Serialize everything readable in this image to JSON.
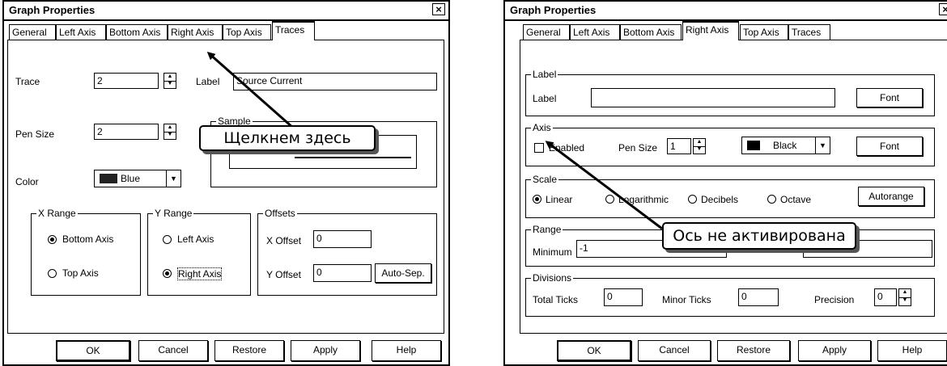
{
  "left_dialog": {
    "title": "Graph Properties",
    "close": "×",
    "tabs": [
      "General",
      "Left Axis",
      "Bottom Axis",
      "Right Axis",
      "Top Axis",
      "Traces"
    ],
    "active_tab": "Traces",
    "trace": {
      "label": "Trace",
      "value": "2"
    },
    "pen_size": {
      "label": "Pen Size",
      "value": "2"
    },
    "label_field": {
      "label": "Label",
      "value": "Source Current"
    },
    "sample": {
      "label": "Sample"
    },
    "color": {
      "label": "Color",
      "value": "Blue",
      "swatch": "#333333"
    },
    "x_range": {
      "label": "X Range",
      "options": [
        "Bottom Axis",
        "Top Axis"
      ],
      "selected": "Bottom Axis"
    },
    "y_range": {
      "label": "Y Range",
      "options": [
        "Left Axis",
        "Right Axis"
      ],
      "selected": "Right Axis"
    },
    "offsets": {
      "label": "Offsets",
      "x_label": "X Offset",
      "x_value": "0",
      "y_label": "Y Offset",
      "y_value": "0",
      "auto_sep": "Auto-Sep."
    },
    "buttons": {
      "ok": "OK",
      "cancel": "Cancel",
      "restore": "Restore",
      "apply": "Apply",
      "help": "Help"
    }
  },
  "right_dialog": {
    "title": "Graph Properties",
    "close": "×",
    "tabs": [
      "General",
      "Left Axis",
      "Bottom Axis",
      "Right Axis",
      "Top Axis",
      "Traces"
    ],
    "active_tab": "Right Axis",
    "label_group": {
      "label": "Label",
      "field_label": "Label",
      "value": "",
      "font": "Font"
    },
    "axis_group": {
      "label": "Axis",
      "enabled": "Enabled",
      "enabled_checked": false,
      "pen_size_label": "Pen Size",
      "pen_size": "1",
      "color": "Black",
      "font": "Font"
    },
    "scale_group": {
      "label": "Scale",
      "options": [
        "Linear",
        "Logarithmic",
        "Decibels",
        "Octave"
      ],
      "selected": "Linear",
      "autorange": "Autorange"
    },
    "range_group": {
      "label": "Range",
      "minimum_label": "Minimum",
      "minimum": "-1"
    },
    "divisions_group": {
      "label": "Divisions",
      "total_ticks_label": "Total Ticks",
      "total_ticks": "0",
      "minor_ticks_label": "Minor Ticks",
      "minor_ticks": "0",
      "precision_label": "Precision",
      "precision": "0"
    },
    "buttons": {
      "ok": "OK",
      "cancel": "Cancel",
      "restore": "Restore",
      "apply": "Apply",
      "help": "Help"
    }
  },
  "callouts": {
    "click_here": "Щелкнем здесь",
    "axis_inactive": "Ось не активирована"
  }
}
